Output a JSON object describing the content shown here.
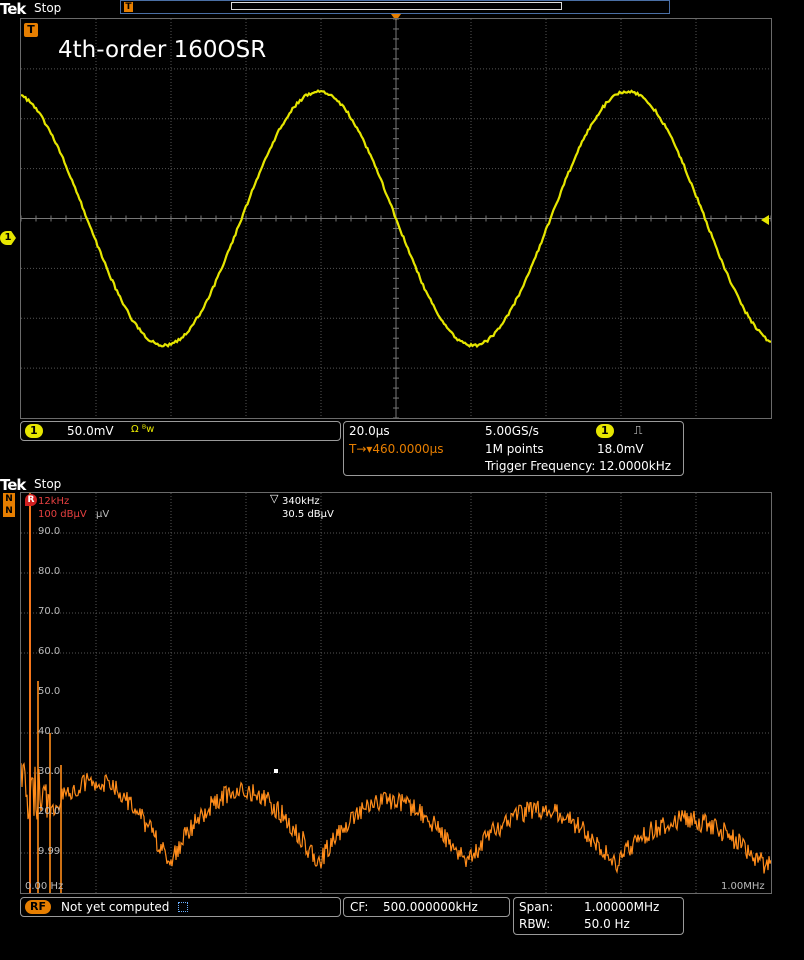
{
  "top": {
    "brand": "Tek",
    "status": "Stop",
    "trigger_marker": "T",
    "title": "4th-order 160OSR",
    "channel_marker": "1",
    "panel1": {
      "channel": "1",
      "volts_div": "50.0mV",
      "icons": "Ω ᴮw"
    },
    "panel2": {
      "time_div": "20.0µs",
      "sample_rate": "5.00GS/s",
      "channel": "1",
      "slope_icon": "⎍",
      "delay": "T→▾460.0000µs",
      "record": "1M points",
      "trigger_level": "18.0mV",
      "trigger_freq": "Trigger Frequency: 12.0000kHz"
    },
    "colors": {
      "trace": "#e6e600",
      "marker": "#e6b800"
    }
  },
  "bottom": {
    "brand": "Tek",
    "status": "Stop",
    "side_markers": [
      "N",
      "N"
    ],
    "ref_marker": "R",
    "marker1_freq": "12kHz",
    "marker1_level": "100 dBµV",
    "marker1_unit": "µV",
    "marker2_symbol": "▽",
    "marker2_freq": "340kHz",
    "marker2_level": "30.5 dBµV",
    "y_labels": [
      "90.0",
      "80.0",
      "70.0",
      "60.0",
      "50.0",
      "40.0",
      "30.0",
      "20.0",
      "9.99"
    ],
    "x_start": "0.00 Hz",
    "x_end": "1.00MHz",
    "panel1": {
      "badge": "RF",
      "text": "Not yet computed"
    },
    "panel2": {
      "label": "CF:",
      "value": "500.000000kHz"
    },
    "panel3": {
      "span_label": "Span:",
      "span_value": "1.00000MHz",
      "rbw_label": "RBW:",
      "rbw_value": "50.0 Hz"
    },
    "colors": {
      "trace": "#ff8c1a",
      "marker": "#d02020"
    }
  }
}
